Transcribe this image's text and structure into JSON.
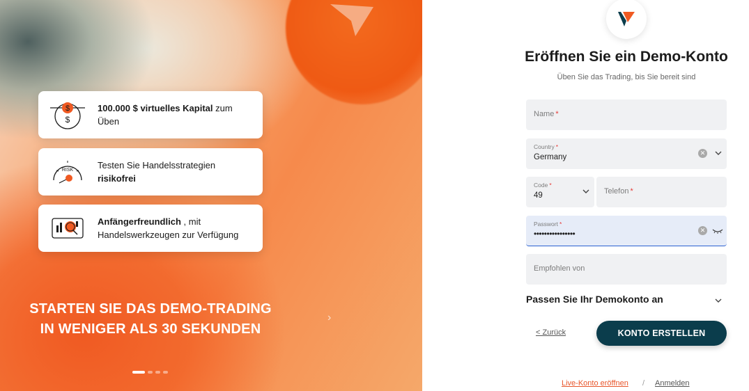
{
  "promo": {
    "features": [
      {
        "bold_prefix": "100.000 $ virtuelles Kapital",
        "text": " zum Üben",
        "icon": "dollar-coin-icon"
      },
      {
        "text_prefix": "Testen Sie Handelsstrategien ",
        "bold_suffix": "risikofrei",
        "icon": "risk-gauge-icon",
        "risk_label": "RISK"
      },
      {
        "bold_prefix": "Anfängerfreundlich",
        "text": " , mit",
        "line2": "Handelswerkzeugen zur Verfügung",
        "icon": "trading-tools-icon"
      }
    ],
    "headline_line1": "STARTEN SIE DAS DEMO-TRADING",
    "headline_line2": "IN WENIGER ALS 30 SEKUNDEN",
    "next_arrow": "›",
    "carousel_slide": 1,
    "carousel_total": 4
  },
  "form": {
    "title": "Eröffnen Sie ein Demo-Konto",
    "subtitle": "Üben Sie das Trading, bis Sie bereit sind",
    "name_label": "Name",
    "country_label": "Country",
    "country_value": "Germany",
    "code_label": "Code",
    "code_value": "49",
    "phone_label": "Telefon",
    "password_label": "Passwort",
    "password_value": "••••••••••••••••",
    "referral_label": "Empfohlen von",
    "required_mark": "*",
    "clear_glyph": "✕",
    "customize_label": "Passen Sie Ihr Demokonto an",
    "back_label": "< Zurück",
    "submit_label": "KONTO ERSTELLEN",
    "live_account_label": "Live-Konto eröffnen",
    "separator": "/",
    "login_label": "Anmelden"
  },
  "colors": {
    "accent_orange": "#f05a22",
    "button_teal": "#0b3d4c",
    "link_orange": "#e8552a",
    "required_red": "#e53935"
  }
}
